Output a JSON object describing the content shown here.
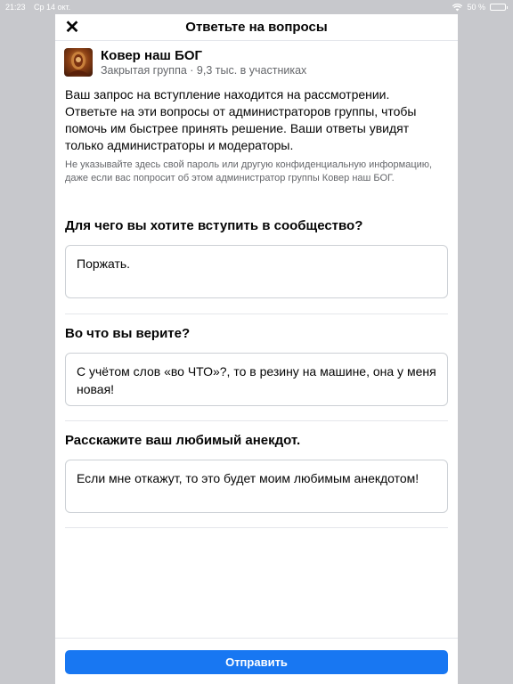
{
  "status_bar": {
    "time": "21:23",
    "date": "Ср 14 окт.",
    "battery": "50 %",
    "battery_level": 0.5
  },
  "header": {
    "title": "Ответьте на вопросы",
    "close_icon": "close-icon"
  },
  "group": {
    "name": "Ковер наш БОГ",
    "meta": "Закрытая группа · 9,3 тыс. в участниках"
  },
  "intro_text": "Ваш запрос на вступление находится на рассмотрении. Ответьте на эти вопросы от администраторов группы, чтобы помочь им быстрее принять решение. Ваши ответы увидят только администраторы и модераторы.",
  "warning_text": "Не указывайте здесь свой пароль или другую конфиденциальную информацию, даже если вас попросит об этом администратор группы Ковер наш БОГ.",
  "questions": [
    {
      "question": "Для чего вы хотите вступить в сообщество?",
      "answer": "Поржать."
    },
    {
      "question": "Во что вы верите?",
      "answer": "С учётом слов «во ЧТО»?, то в резину на машине, она у меня новая!"
    },
    {
      "question": "Расскажите ваш любимый анекдот.",
      "answer": "Если мне откажут, то это будет моим любимым анекдотом!"
    }
  ],
  "submit_label": "Отправить",
  "colors": {
    "accent": "#1877f2",
    "background": "#c7c8cc",
    "secondary_text": "#65676b"
  }
}
